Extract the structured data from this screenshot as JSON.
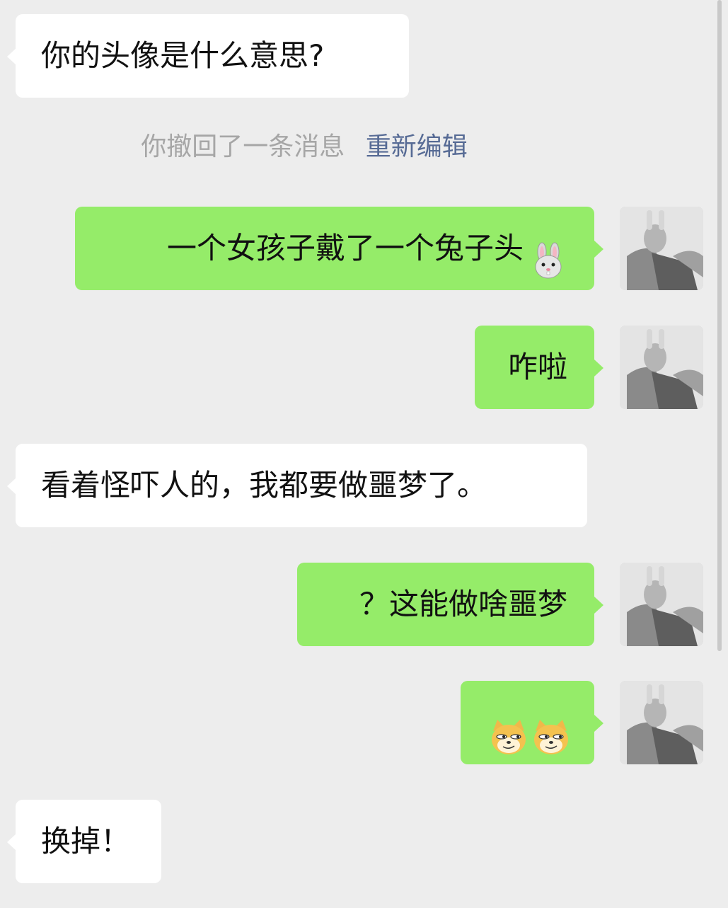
{
  "colors": {
    "background": "#ededed",
    "incoming_bubble": "#ffffff",
    "outgoing_bubble": "#95ec69",
    "system_text": "#a6a6a6",
    "link_text": "#576b95"
  },
  "messages": [
    {
      "direction": "in",
      "text": "你的头像是什么意思?"
    },
    {
      "direction": "out",
      "text": "一个女孩子戴了一个兔子头",
      "emoji": "rabbit-face-icon"
    },
    {
      "direction": "out",
      "text": "咋啦"
    },
    {
      "direction": "in",
      "text": "看着怪吓人的，我都要做噩梦了。"
    },
    {
      "direction": "out",
      "text": "？这能做啥噩梦"
    },
    {
      "direction": "out",
      "text": "",
      "emoji": "smirk-doge-icon x2"
    },
    {
      "direction": "in",
      "text": "换掉！"
    }
  ],
  "system_note": {
    "recalled": "你撤回了一条消息",
    "re_edit": "重新编辑"
  }
}
